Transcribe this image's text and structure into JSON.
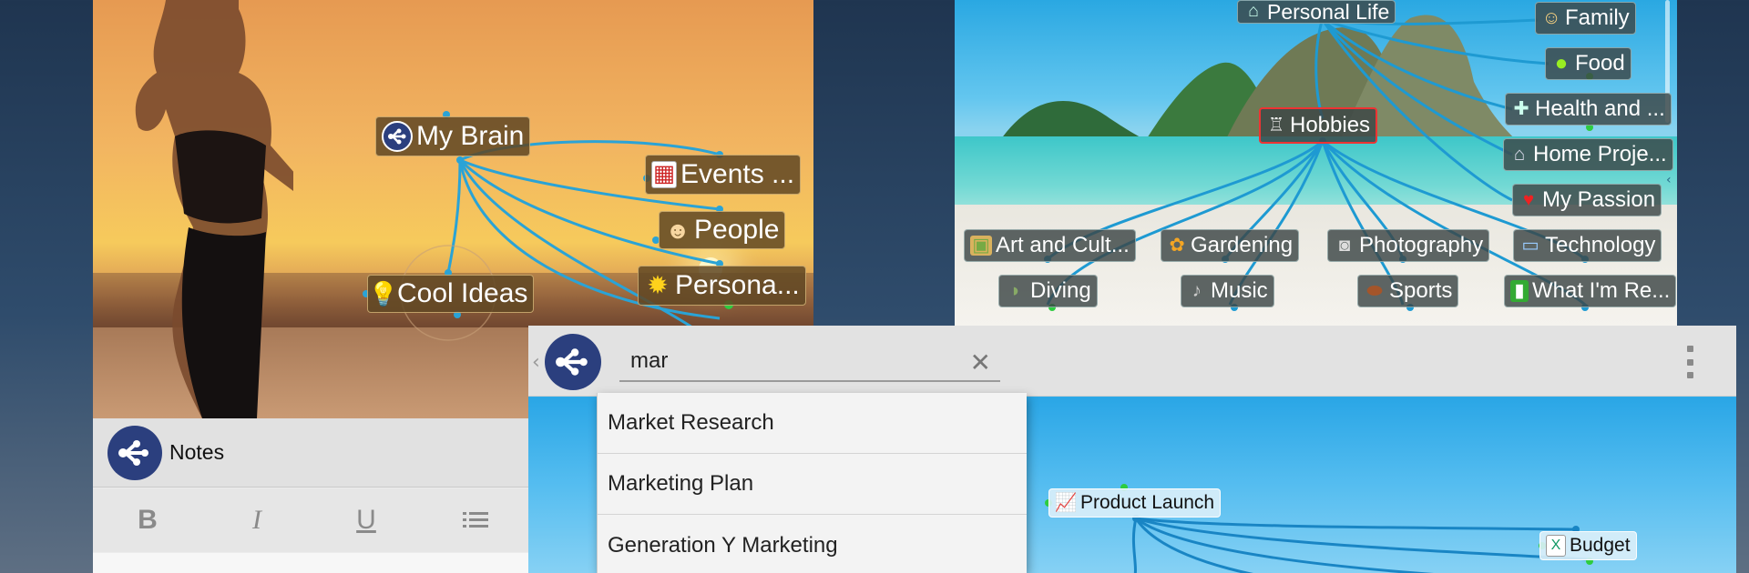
{
  "left_map": {
    "central": "My Brain",
    "nodes": [
      "Events ...",
      "People",
      "Persona...",
      "Cool Ideas"
    ]
  },
  "right_map": {
    "top_node": "Personal Life",
    "central": "Hobbies",
    "right_column": [
      "Family",
      "Food",
      "Health and ...",
      "Home Proje...",
      "My Passion"
    ],
    "row1": [
      "Art and Cult...",
      "Gardening",
      "Photography",
      "Technology"
    ],
    "row2": [
      "Diving",
      "Music",
      "Sports",
      "What I'm Re..."
    ]
  },
  "notes": {
    "title": "Notes",
    "toolbar": {
      "bold": "B",
      "italic": "I",
      "underline": "U"
    }
  },
  "search": {
    "value": "mar",
    "results": [
      "Market Research",
      "Marketing Plan",
      "Generation Y Marketing"
    ]
  },
  "bottom_map": {
    "nodes": [
      "Product Launch",
      "Budget"
    ]
  },
  "colors": {
    "link": "#2aa3d6",
    "brand": "#2b3f7e",
    "selected_border": "#ee3333"
  },
  "icons": {
    "events": "calendar-icon",
    "people": "person-icon",
    "persona": "sun-icon",
    "cool_ideas": "lightbulb-icon"
  }
}
